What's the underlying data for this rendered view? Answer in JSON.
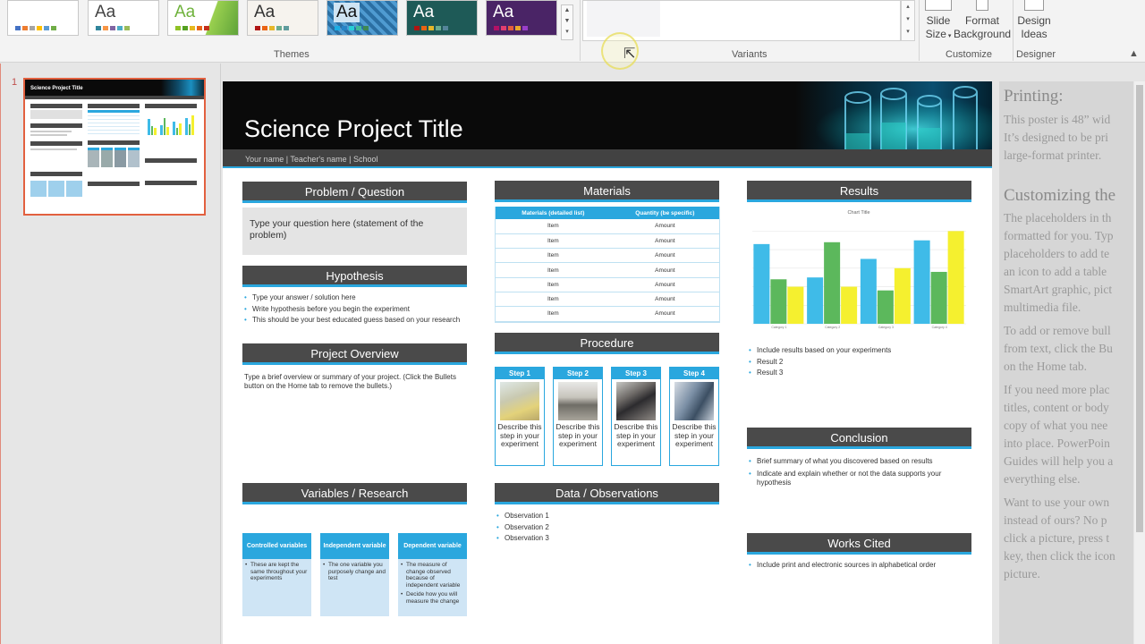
{
  "ribbon": {
    "themes_label": "Themes",
    "variants_label": "Variants",
    "customize_label": "Customize",
    "designer_label": "Designer",
    "theme_sample_text": "Aa",
    "slide_size": [
      "Slide",
      "Size"
    ],
    "format_background": [
      "Format",
      "Background"
    ],
    "design_ideas": [
      "Design",
      "Ideas"
    ]
  },
  "thumbnail": {
    "number": "1",
    "title": "Science Project Title"
  },
  "slide": {
    "title": "Science Project Title",
    "subtitle": "Your name | Teacher's name | School",
    "problem": {
      "heading": "Problem / Question",
      "text": "Type your question here (statement of the problem)"
    },
    "hypothesis": {
      "heading": "Hypothesis",
      "bullets": [
        "Type your answer / solution here",
        "Write hypothesis before you begin the experiment",
        "This should be your best educated guess based on your research"
      ]
    },
    "overview": {
      "heading": "Project Overview",
      "text": "Type a brief overview or summary of your project. (Click the Bullets button on the Home tab to remove the bullets.)"
    },
    "variables": {
      "heading": "Variables / Research",
      "columns": [
        {
          "title": "Controlled variables",
          "bullets": [
            "These are kept the same throughout your experiments"
          ]
        },
        {
          "title": "Independent variable",
          "bullets": [
            "The one variable you purposely change and test"
          ]
        },
        {
          "title": "Dependent variable",
          "bullets": [
            "The measure of change observed because of independent variable",
            "Decide how you will measure the change"
          ]
        }
      ]
    },
    "materials": {
      "heading": "Materials",
      "col1": "Materials (detailed list)",
      "col2": "Quantity (be specific)",
      "rows": [
        [
          "Item",
          "Amount"
        ],
        [
          "Item",
          "Amount"
        ],
        [
          "Item",
          "Amount"
        ],
        [
          "Item",
          "Amount"
        ],
        [
          "Item",
          "Amount"
        ],
        [
          "Item",
          "Amount"
        ],
        [
          "Item",
          "Amount"
        ]
      ]
    },
    "procedure": {
      "heading": "Procedure",
      "steps": [
        {
          "label": "Step 1",
          "text": "Describe this step in your experiment"
        },
        {
          "label": "Step 2",
          "text": "Describe this step in your experiment"
        },
        {
          "label": "Step 3",
          "text": "Describe this step in your experiment"
        },
        {
          "label": "Step 4",
          "text": "Describe this step in your experiment"
        }
      ]
    },
    "observations": {
      "heading": "Data / Observations",
      "bullets": [
        "Observation 1",
        "Observation 2",
        "Observation 3"
      ]
    },
    "results": {
      "heading": "Results",
      "bullets": [
        "Include results based on your experiments",
        "Result 2",
        "Result 3"
      ]
    },
    "conclusion": {
      "heading": "Conclusion",
      "bullets": [
        "Brief summary of what you discovered based on results",
        "Indicate and explain whether or not the data supports your hypothesis"
      ]
    },
    "works_cited": {
      "heading": "Works Cited",
      "bullets": [
        "Include print and electronic sources in alphabetical order"
      ]
    }
  },
  "chart_data": {
    "type": "bar",
    "title": "Chart Title",
    "categories": [
      "Category 1",
      "Category 2",
      "Category 3",
      "Category 4"
    ],
    "series": [
      {
        "values": [
          4.3,
          2.5,
          3.5,
          4.5
        ],
        "color": "#3fbbe8"
      },
      {
        "values": [
          2.4,
          4.4,
          1.8,
          2.8
        ],
        "color": "#5cb85c"
      },
      {
        "values": [
          2.0,
          2.0,
          3.0,
          5.0
        ],
        "color": "#f5f02f"
      }
    ],
    "ylim": [
      0,
      5.5
    ],
    "grid": true
  },
  "right_pane": {
    "heading1": "Printing:",
    "lines1": [
      "This poster is 48” wid",
      "It’s designed to be pri",
      "large-format printer."
    ],
    "heading2": "Customizing the",
    "lines2": [
      "The placeholders in th",
      "formatted for you. Typ",
      "placeholders to add te",
      "an icon to add a table",
      "SmartArt graphic, pict",
      "multimedia file."
    ],
    "lines3": [
      "To add or remove bull",
      "from text, click the Bu",
      "on the Home tab."
    ],
    "lines4": [
      "If you need more plac",
      "titles, content or body",
      "copy of what you nee",
      "into place. PowerPoin",
      "Guides will help you a",
      "everything else."
    ],
    "lines5": [
      "Want to use your own",
      "instead of ours? No p",
      "click a picture, press t",
      "key, then click the icon",
      "picture."
    ]
  },
  "colors": {
    "accent": "#2aa7de",
    "header_bar": "#4a4a4a",
    "selection": "#e2603f"
  }
}
